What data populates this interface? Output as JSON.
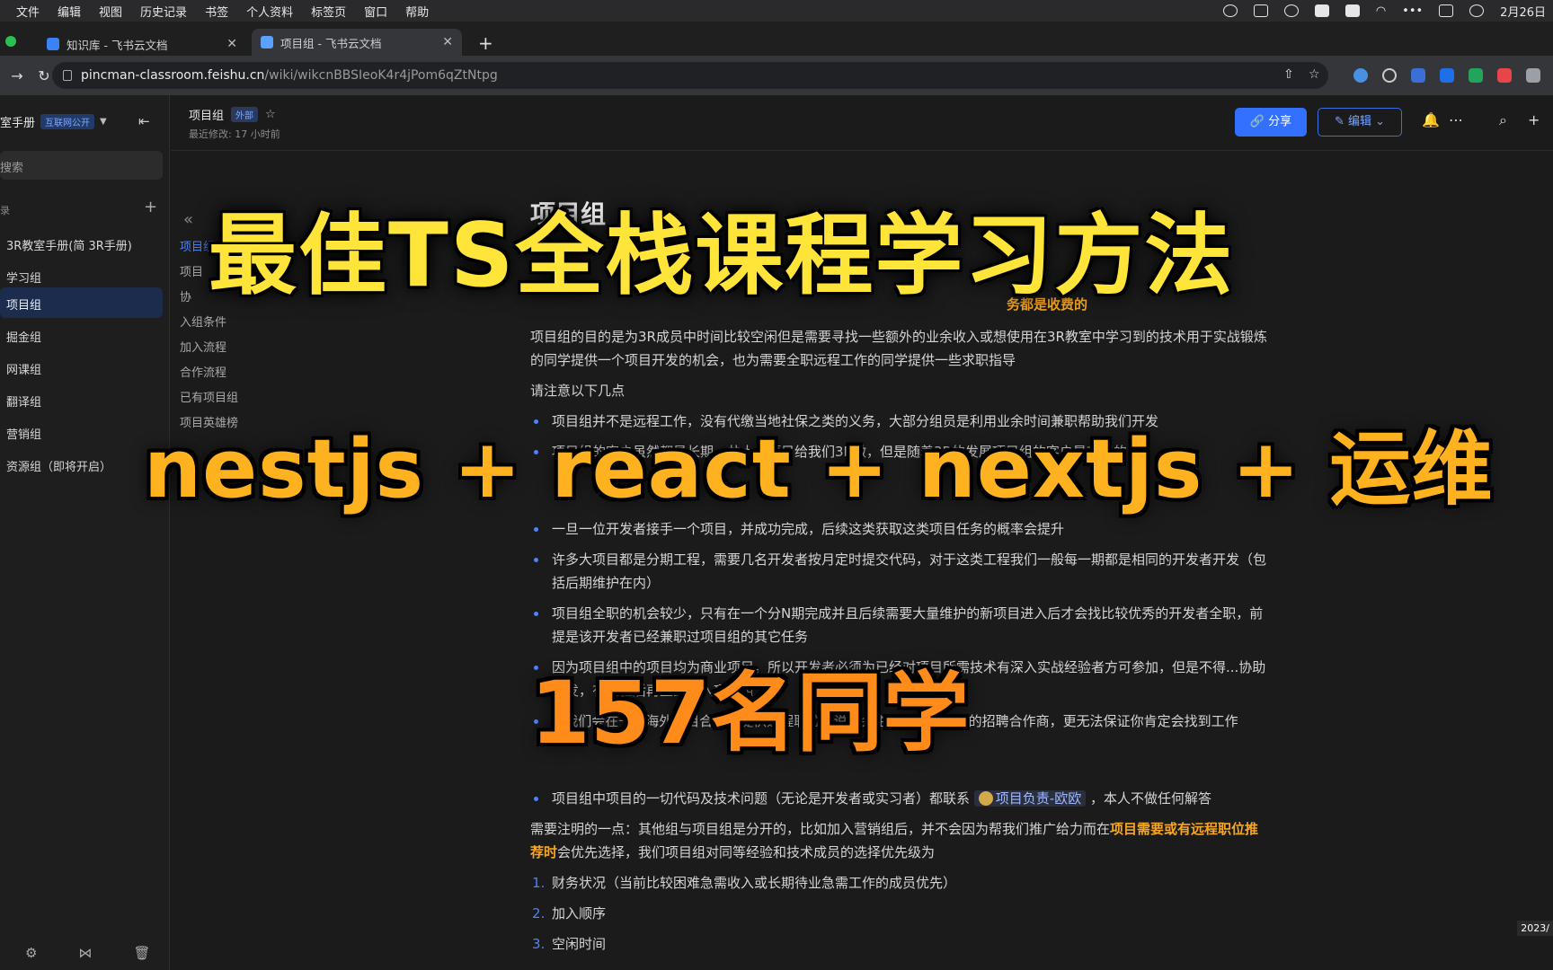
{
  "menubar": {
    "items": [
      "文件",
      "编辑",
      "视图",
      "历史记录",
      "书签",
      "个人资料",
      "标签页",
      "窗口",
      "帮助"
    ],
    "clock": "2月26日"
  },
  "tabs": [
    {
      "label": "知识库 - 飞书云文档"
    },
    {
      "label": "项目组 - 飞书云文档"
    }
  ],
  "address": {
    "host": "pincman-classroom.feishu.cn",
    "path": "/wiki/wikcnBBSIeoK4r4jPom6qZtNtpg"
  },
  "sidebar": {
    "title": "室手册",
    "badge": "互联网公开",
    "search_placeholder": "搜索",
    "dir_label": "录",
    "items": [
      {
        "label": "3R教室手册(简 3R手册)"
      },
      {
        "label": "学习组"
      },
      {
        "label": "项目组"
      },
      {
        "label": "掘金组"
      },
      {
        "label": "网课组"
      },
      {
        "label": "翻译组"
      },
      {
        "label": "营销组"
      },
      {
        "label": "资源组（即将开启）"
      }
    ]
  },
  "doc_header": {
    "title": "项目组",
    "tag": "外部",
    "modified": "最近修改: 17 小时前",
    "share": "分享",
    "edit": "编辑"
  },
  "outline": {
    "items": [
      "项目组",
      "项目",
      "协",
      "入组条件",
      "加入流程",
      "合作流程",
      "已有项目组",
      "项目英雄榜"
    ]
  },
  "doc": {
    "title": "项目组",
    "hidden_line": "务都是收费的",
    "intro": "项目组的目的是为3R成员中时间比较空闲但是需要寻找一些额外的业余收入或想使用在3R教室中学习到的技术用于实战锻炼的同学提供一个项目开发的机会，也为需要全职远程工作的同学提供一些求职指导",
    "notice": "请注意以下几点",
    "bullets": [
      "项目组并不是远程工作，没有代缴当地社保之类的义务，大部分组员是利用业余时间兼职帮助我们开发",
      "项目组的客户虽然都是长期，共大量项目给我们3R做，但是随着3R的发展项目组的客户是有限的",
      "一旦一位开发者接手一个项目，并成功完成，后续这类获取这类项目任务的概率会提升",
      "许多大项目都是分期工程，需要几名开发者按月定时提交代码，对于这类工程我们一般每一期都是相同的开发者开发（包括后期维护在内）",
      "项目组全职的机会较少，只有在一个分N期完成并且后续需要大量维护的新项目进入后才会找比较优秀的开发者全职，前提是该开发者已经兼职过项目组的其它任务",
      "因为项目组中的项目均为商业项目，所以开发者必须为已经对项目所需技术有深入实战经验者方可参加，但是不得...协助开发，有经验后再正式加入项目组",
      "...我们会在一些海外项目合作方提供远程职位...说不会主动再去寻找新的招聘合作商，更无法保证你肯定会找到工作"
    ],
    "contact_prefix": "项目组中项目的一切代码及技术问题（无论是开发者或实习者）都联系",
    "contact_mention": "项目负责-欧欧",
    "contact_suffix": "，本人不做任何解答",
    "note_prefix": "需要注明的一点：其他组与项目组是分开的，比如加入营销组后，并不会因为帮我们推广给力而在",
    "note_highlight": "项目需要或有远程职位推荐时",
    "note_suffix": "会优先选择，我们项目组对同等经验和技术成员的选择优先级为",
    "ordered": [
      {
        "n": "1.",
        "text": "财务状况（当前比较困难急需收入或长期待业急需工作的成员优先）"
      },
      {
        "n": "2.",
        "text": "加入顺序"
      },
      {
        "n": "3.",
        "text": "空闲时间"
      }
    ]
  },
  "overlay": {
    "title": "最佳TS全栈课程学习方法",
    "stack": "nestjs + react + nextjs + 运维",
    "count": "157名同学"
  },
  "corner": "2023/",
  "colors": {
    "accent": "#3370ff",
    "overlay_yellow": "#ffe43a",
    "overlay_orange": "#ffb21f",
    "highlight": "#f5a623"
  }
}
